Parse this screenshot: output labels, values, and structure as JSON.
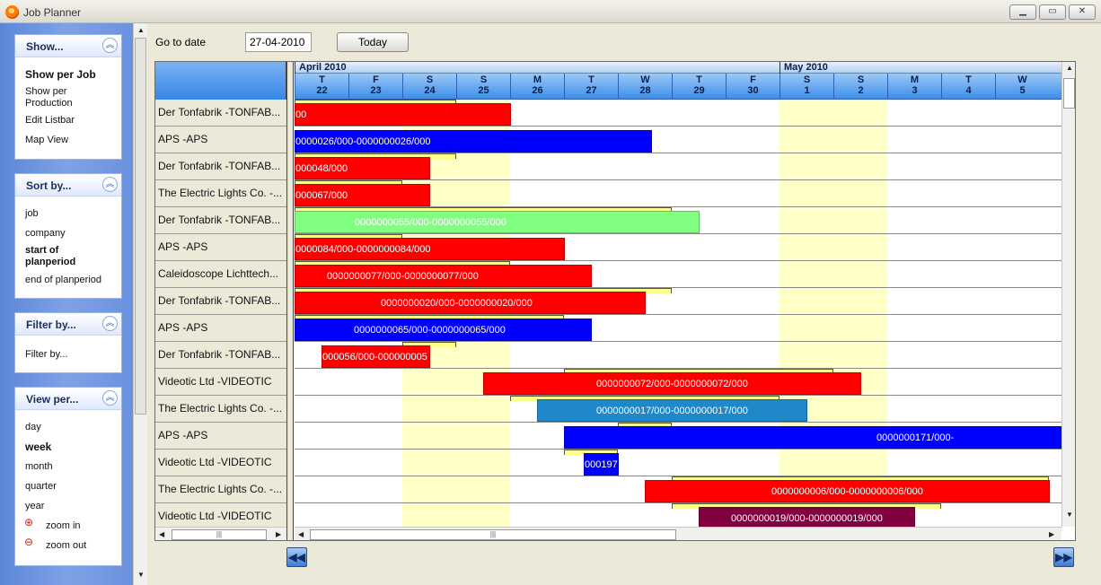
{
  "window": {
    "title": "Job Planner"
  },
  "sidebar": {
    "show": {
      "title": "Show...",
      "items": [
        "Show per Job",
        "Show per Production",
        "Edit Listbar",
        "Map View"
      ]
    },
    "sort": {
      "title": "Sort by...",
      "items": [
        "job",
        "company",
        "start of planperiod",
        "end of planperiod"
      ]
    },
    "filter": {
      "title": "Filter by...",
      "items": [
        "Filter by..."
      ]
    },
    "view": {
      "title": "View per...",
      "items": [
        "day",
        "week",
        "month",
        "quarter",
        "year"
      ],
      "zoom_in": "zoom in",
      "zoom_out": "zoom out"
    }
  },
  "toolbar": {
    "goto_label": "Go to date",
    "date_value": "27-04-2010",
    "today_label": "Today"
  },
  "timeline": {
    "months": [
      "April 2010",
      "May 2010"
    ],
    "days": [
      {
        "letter": "T",
        "num": "22"
      },
      {
        "letter": "F",
        "num": "23"
      },
      {
        "letter": "S",
        "num": "24"
      },
      {
        "letter": "S",
        "num": "25"
      },
      {
        "letter": "M",
        "num": "26"
      },
      {
        "letter": "T",
        "num": "27"
      },
      {
        "letter": "W",
        "num": "28"
      },
      {
        "letter": "T",
        "num": "29"
      },
      {
        "letter": "F",
        "num": "30"
      },
      {
        "letter": "S",
        "num": "1"
      },
      {
        "letter": "S",
        "num": "2"
      },
      {
        "letter": "M",
        "num": "3"
      },
      {
        "letter": "T",
        "num": "4"
      },
      {
        "letter": "W",
        "num": "5"
      }
    ]
  },
  "rows": [
    "Der Tonfabrik -TONFAB...",
    "APS -APS",
    "Der Tonfabrik -TONFAB...",
    "The Electric Lights Co. -...",
    "Der Tonfabrik -TONFAB...",
    "APS -APS",
    "Caleidoscope Lichttech...",
    "Der Tonfabrik -TONFAB...",
    "APS -APS",
    "Der Tonfabrik -TONFAB...",
    "Videotic Ltd -VIDEOTIC",
    "The Electric Lights Co. -...",
    "APS -APS",
    "Videotic Ltd -VIDEOTIC",
    "The Electric Lights Co. -...",
    "Videotic Ltd -VIDEOTIC"
  ],
  "bars": [
    {
      "text": "00",
      "color": "#ff0000"
    },
    {
      "text": "0000026/000-0000000026/000",
      "color": "#0000ff"
    },
    {
      "text": "000048/000",
      "color": "#ff0000"
    },
    {
      "text": "000067/000",
      "color": "#ff0000"
    },
    {
      "text": "0000000055/000-0000000055/000",
      "color": "#80ff80"
    },
    {
      "text": "0000084/000-0000000084/000",
      "color": "#ff0000"
    },
    {
      "text": "0000000077/000-0000000077/000",
      "color": "#ff0000"
    },
    {
      "text": "0000000020/000-0000000020/000",
      "color": "#ff0000"
    },
    {
      "text": "0000000065/000-0000000065/000",
      "color": "#0000ff"
    },
    {
      "text": "000056/000-000000005",
      "color": "#ff0000"
    },
    {
      "text": "0000000072/000-0000000072/000",
      "color": "#ff0000"
    },
    {
      "text": "0000000017/000-0000000017/000",
      "color": "#1e88c8"
    },
    {
      "text": "0000000171/000-",
      "color": "#0000ff"
    },
    {
      "text": "000197",
      "color": "#0000ff"
    },
    {
      "text": "0000000006/000-0000000006/000",
      "color": "#ff0000"
    },
    {
      "text": "0000000019/000-0000000019/000",
      "color": "#800040"
    }
  ],
  "nav": {
    "prev": "◀◀",
    "next": "▶▶"
  }
}
